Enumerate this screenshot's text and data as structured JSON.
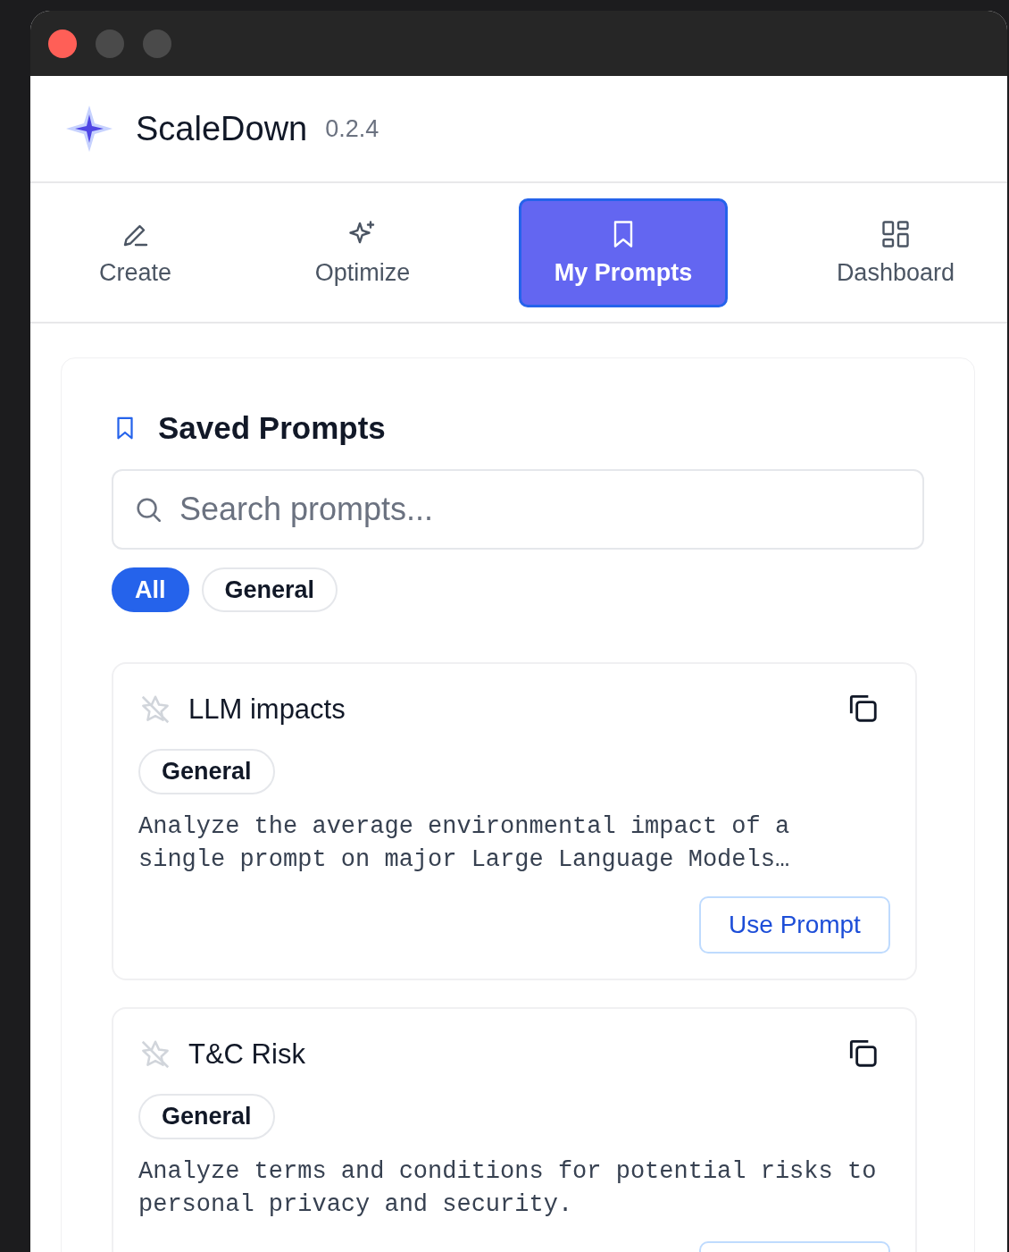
{
  "app": {
    "name": "ScaleDown",
    "version": "0.2.4"
  },
  "tabs": [
    {
      "label": "Create",
      "selected": false
    },
    {
      "label": "Optimize",
      "selected": false
    },
    {
      "label": "My Prompts",
      "selected": true
    },
    {
      "label": "Dashboard",
      "selected": false
    }
  ],
  "section_title": "Saved Prompts",
  "search": {
    "placeholder": "Search prompts..."
  },
  "filters": [
    {
      "label": "All",
      "selected": true
    },
    {
      "label": "General",
      "selected": false
    }
  ],
  "prompts": [
    {
      "title": "LLM impacts",
      "tag": "General",
      "description": "Analyze the average environmental impact of a single prompt on major Large Language Models…",
      "action": "Use Prompt"
    },
    {
      "title": "T&C Risk",
      "tag": "General",
      "description": "Analyze terms and conditions for potential risks to personal privacy and security."
    }
  ]
}
